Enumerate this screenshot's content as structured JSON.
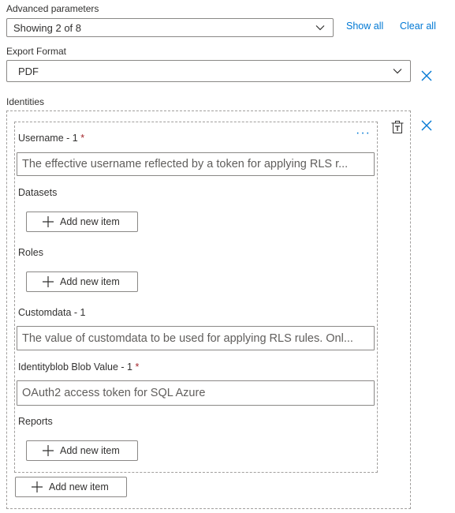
{
  "advanced": {
    "label": "Advanced parameters",
    "select_value": "Showing 2 of 8",
    "show_all": "Show all",
    "clear_all": "Clear all"
  },
  "export_format": {
    "label": "Export Format",
    "value": "PDF"
  },
  "identities": {
    "label": "Identities",
    "more": "···",
    "username": {
      "label": "Username - 1",
      "required": "*",
      "placeholder": "The effective username reflected by a token for applying RLS r..."
    },
    "datasets": {
      "label": "Datasets",
      "add": "Add new item"
    },
    "roles": {
      "label": "Roles",
      "add": "Add new item"
    },
    "customdata": {
      "label": "Customdata - 1",
      "placeholder": "The value of customdata to be used for applying RLS rules. Onl..."
    },
    "identityblob": {
      "label": "Identityblob Blob Value - 1",
      "required": "*",
      "placeholder": "OAuth2 access token for SQL Azure"
    },
    "reports": {
      "label": "Reports",
      "add": "Add new item"
    },
    "add_outer": "Add new item"
  },
  "colors": {
    "accent": "#0078d4",
    "required": "#a4262c"
  }
}
